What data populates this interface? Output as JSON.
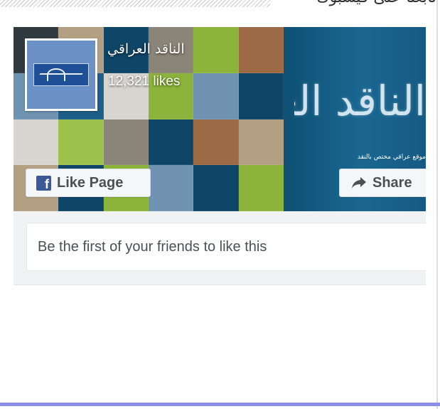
{
  "header": {
    "heading": "تابعنا على فيسبوك"
  },
  "page_plugin": {
    "page_name": "الناقد العراقي",
    "likes": "12,321 likes",
    "like_button_label": "Like Page",
    "share_button_label": "Share",
    "friends_text": "Be the first of your friends to like this",
    "cover_title": "الناقد العراقي",
    "cover_tagline": "موقع عراقي مختص بالنقد",
    "icons": {
      "like": "facebook-icon",
      "share": "share-arrow-icon"
    },
    "colors": {
      "facebook_blue": "#3b5998",
      "cover_blue": "#0f5074",
      "cover_green": "#8cb43a",
      "bottom_bar": "#8d8ce6"
    }
  }
}
